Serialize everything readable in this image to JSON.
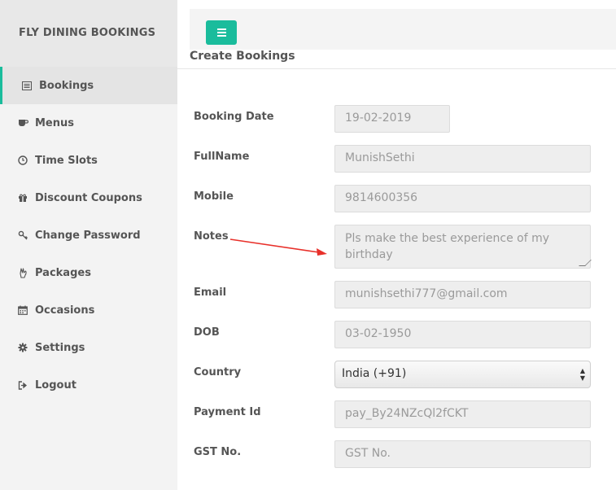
{
  "brand": "FLY DINING BOOKINGS",
  "sidebar": {
    "items": [
      {
        "label": "Bookings",
        "icon": "list-icon"
      },
      {
        "label": "Menus",
        "icon": "coffee-icon"
      },
      {
        "label": "Time Slots",
        "icon": "clock-icon"
      },
      {
        "label": "Discount Coupons",
        "icon": "gift-icon"
      },
      {
        "label": "Change Password",
        "icon": "key-icon"
      },
      {
        "label": "Packages",
        "icon": "hand-icon"
      },
      {
        "label": "Occasions",
        "icon": "calendar-icon"
      },
      {
        "label": "Settings",
        "icon": "gear-icon"
      },
      {
        "label": "Logout",
        "icon": "logout-icon"
      }
    ]
  },
  "panel": {
    "title": "Create Bookings"
  },
  "form": {
    "booking_date": {
      "label": "Booking Date",
      "value": "19-02-2019"
    },
    "fullname": {
      "label": "FullName",
      "value": "MunishSethi"
    },
    "mobile": {
      "label": "Mobile",
      "value": "9814600356"
    },
    "notes": {
      "label": "Notes",
      "value": "Pls make the best experience of my birthday"
    },
    "email": {
      "label": "Email",
      "value": "munishsethi777@gmail.com"
    },
    "dob": {
      "label": "DOB",
      "value": "03-02-1950"
    },
    "country": {
      "label": "Country",
      "value": "India (+91)"
    },
    "payment_id": {
      "label": "Payment Id",
      "value": "pay_By24NZcQl2fCKT"
    },
    "gst_no": {
      "label": "GST No.",
      "placeholder": "GST No."
    }
  },
  "colors": {
    "accent": "#1abc9c",
    "annotation_arrow": "#e8302a"
  }
}
